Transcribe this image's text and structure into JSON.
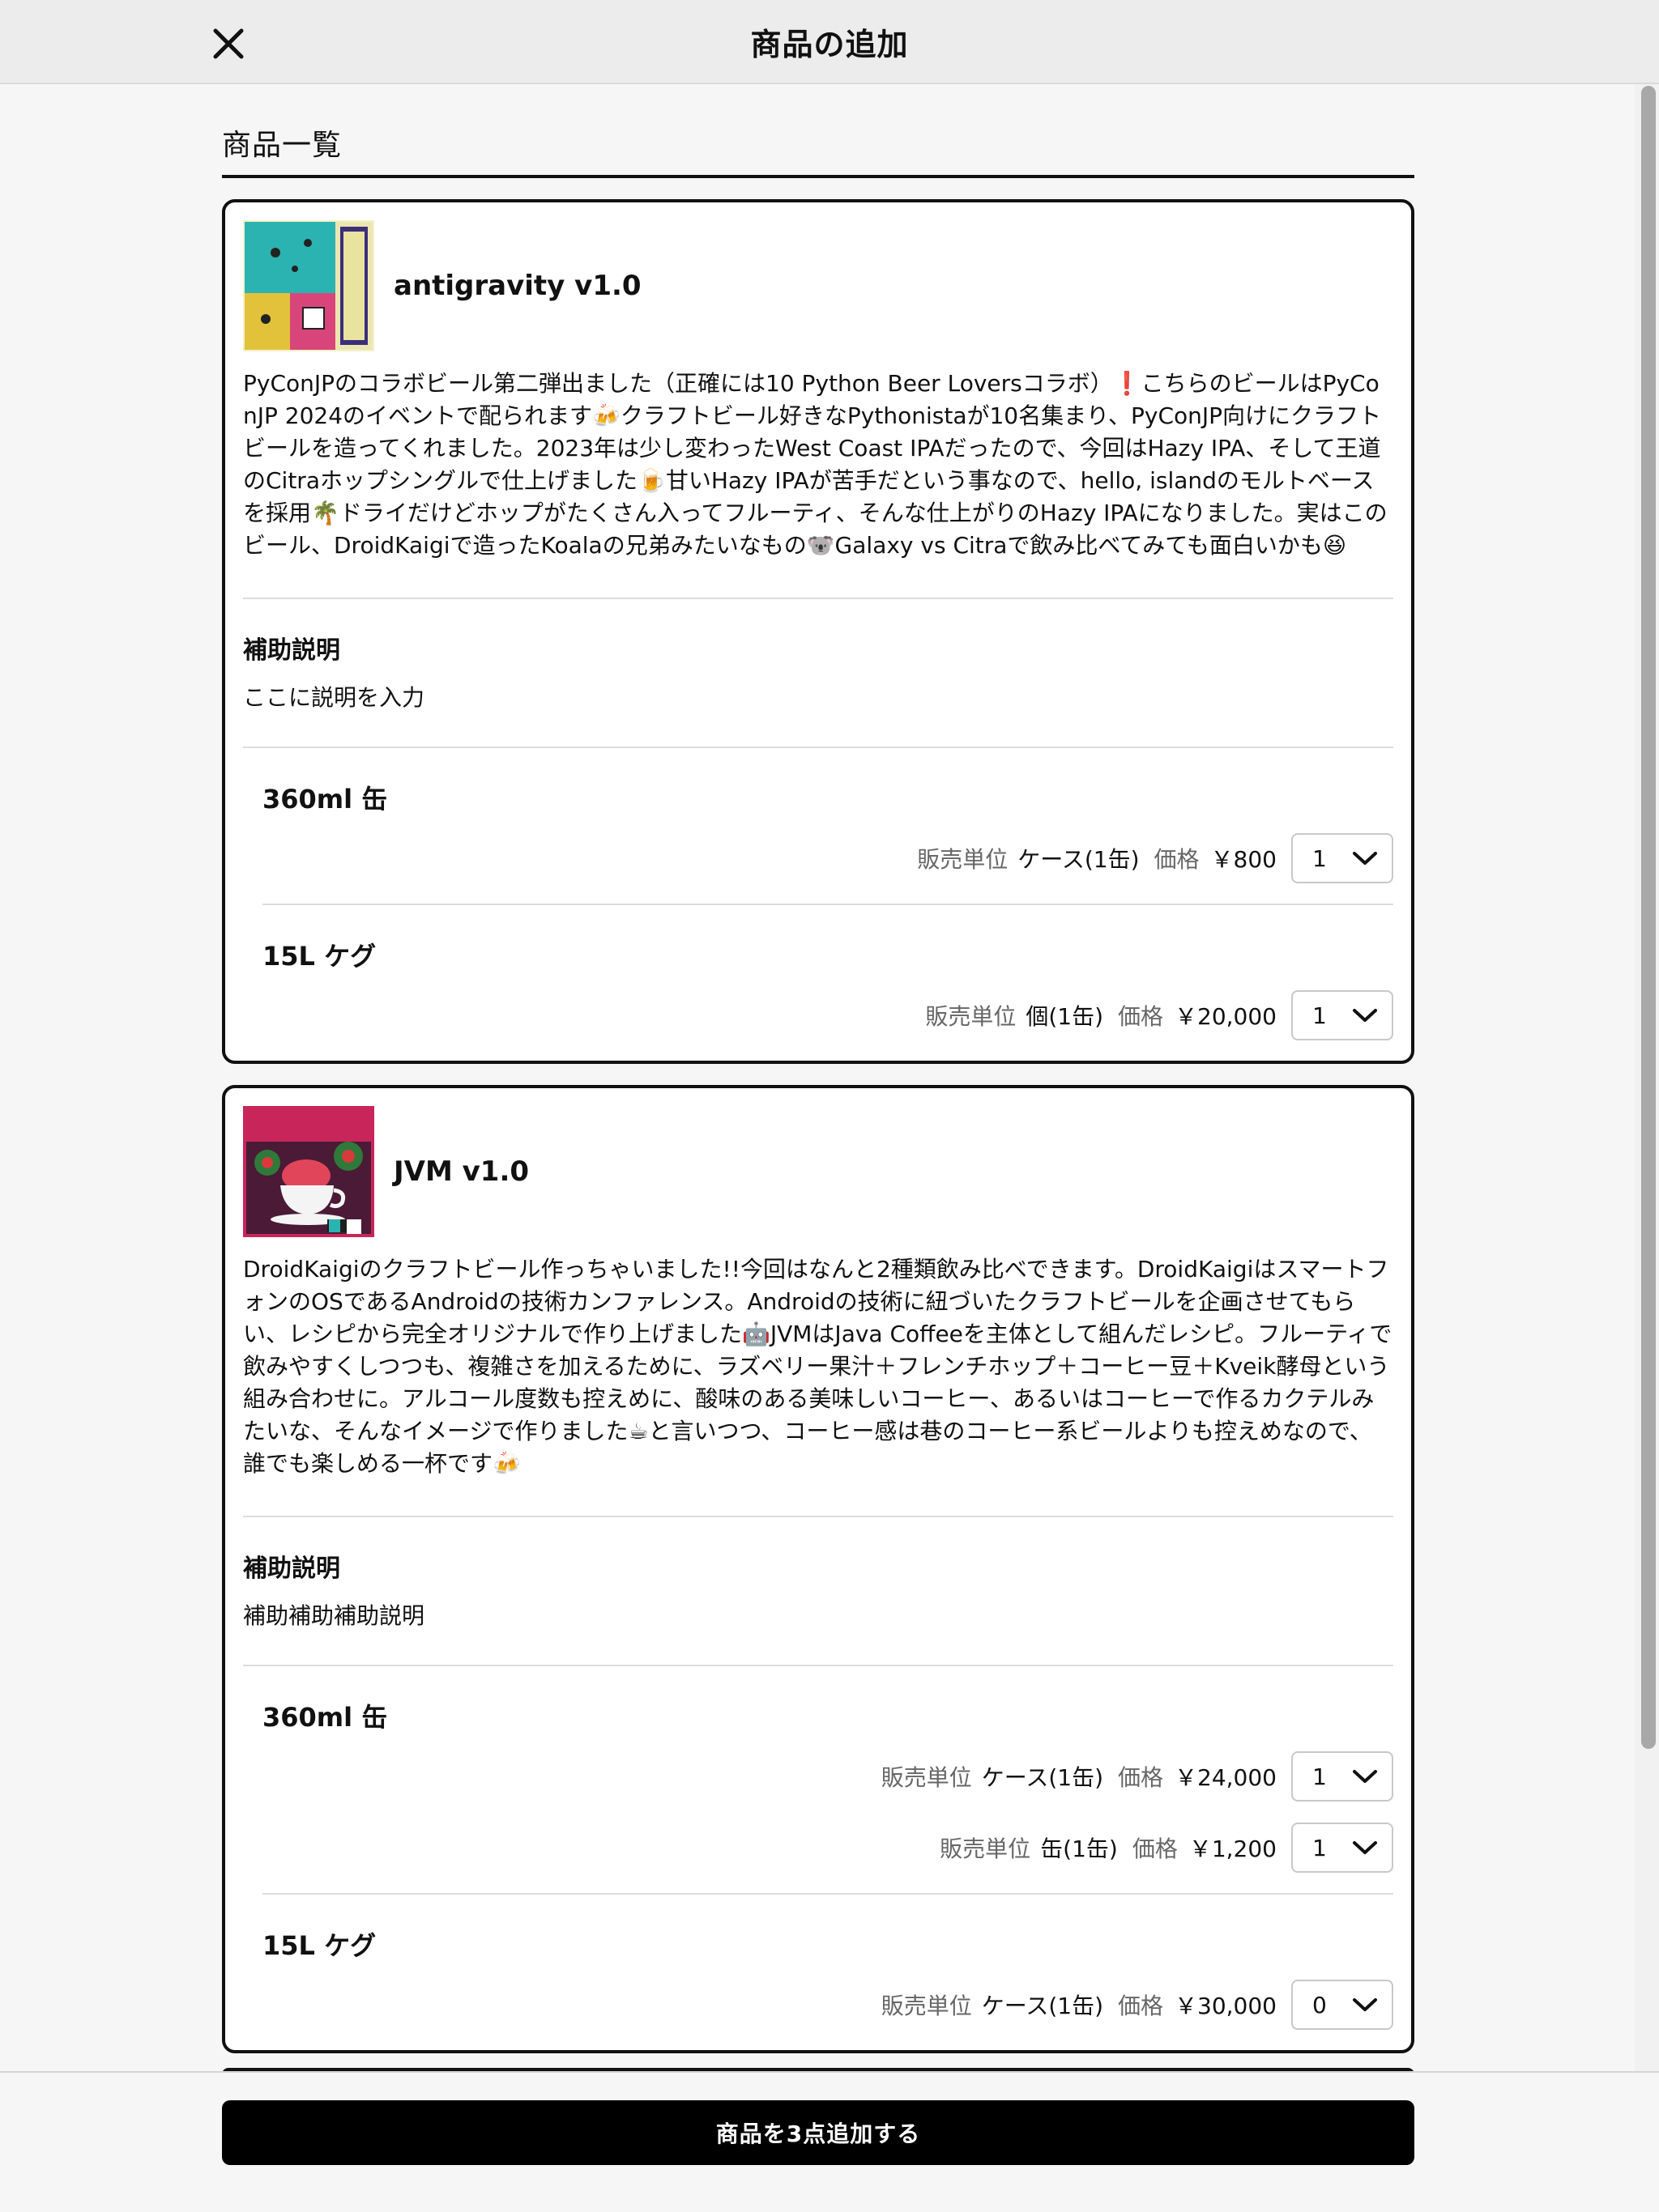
{
  "header": {
    "title": "商品の追加"
  },
  "section": {
    "title": "商品一覧"
  },
  "products": [
    {
      "name": "antigravity v1.0",
      "description": "PyConJPのコラボビール第二弾出ました（正確には10 Python Beer Loversコラボ）❗こちらのビールはPyConJP 2024のイベントで配られます🍻クラフトビール好きなPythonistaが10名集まり、PyConJP向けにクラフトビールを造ってくれました。2023年は少し変わったWest Coast IPAだったので、今回はHazy IPA、そして王道のCitraホップシングルで仕上げました🍺甘いHazy IPAが苦手だという事なので、hello, islandのモルトベースを採用🌴ドライだけどホップがたくさん入ってフルーティ、そんな仕上がりのHazy IPAになりました。実はこのビール、DroidKaigiで造ったKoalaの兄弟みたいなもの🐨Galaxy vs Citraで飲み比べてみても面白いかも😆",
      "aux_label": "補助説明",
      "aux_text": "ここに説明を入力",
      "variants": [
        {
          "name": "360ml 缶",
          "rows": [
            {
              "unit_label": "販売単位",
              "unit": "ケース(1缶)",
              "price_label": "価格",
              "price": "￥800",
              "qty": "1"
            }
          ]
        },
        {
          "name": "15L ケグ",
          "rows": [
            {
              "unit_label": "販売単位",
              "unit": "個(1缶)",
              "price_label": "価格",
              "price": "￥20,000",
              "qty": "1"
            }
          ]
        }
      ]
    },
    {
      "name": "JVM v1.0",
      "description": "DroidKaigiのクラフトビール作っちゃいました!!今回はなんと2種類飲み比べできます。DroidKaigiはスマートフォンのOSであるAndroidの技術カンファレンス。Androidの技術に紐づいたクラフトビールを企画させてもらい、レシピから完全オリジナルで作り上げました🤖JVMはJava Coffeeを主体として組んだレシピ。フルーティで飲みやすくしつつも、複雑さを加えるために、ラズベリー果汁＋フレンチホップ＋コーヒー豆＋Kveik酵母という組み合わせに。アルコール度数も控えめに、酸味のある美味しいコーヒー、あるいはコーヒーで作るカクテルみたいな、そんなイメージで作りました☕と言いつつ、コーヒー感は巷のコーヒー系ビールよりも控えめなので、誰でも楽しめる一杯です🍻",
      "aux_label": "補助説明",
      "aux_text": "補助補助補助説明",
      "variants": [
        {
          "name": "360ml 缶",
          "rows": [
            {
              "unit_label": "販売単位",
              "unit": "ケース(1缶)",
              "price_label": "価格",
              "price": "￥24,000",
              "qty": "1"
            },
            {
              "unit_label": "販売単位",
              "unit": "缶(1缶)",
              "price_label": "価格",
              "price": "￥1,200",
              "qty": "1"
            }
          ]
        },
        {
          "name": "15L ケグ",
          "rows": [
            {
              "unit_label": "販売単位",
              "unit": "ケース(1缶)",
              "price_label": "価格",
              "price": "￥30,000",
              "qty": "0"
            }
          ]
        }
      ]
    }
  ],
  "footer": {
    "submit_label": "商品を3点追加する"
  },
  "icons": {
    "close": "close-icon",
    "chevron": "chevron-down-icon"
  }
}
